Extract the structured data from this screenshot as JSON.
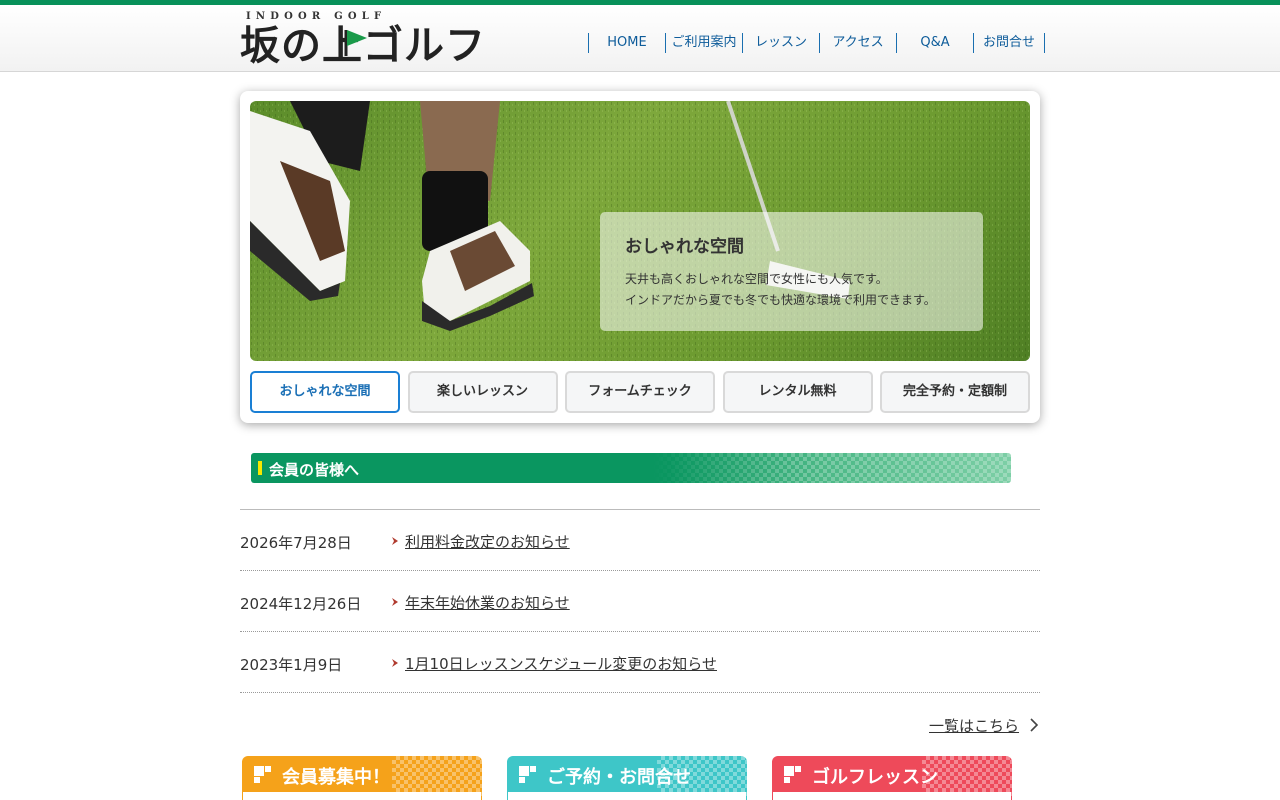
{
  "header": {
    "logo_sub": "INDOOR GOLF",
    "logo_main_1": "坂の",
    "logo_main_2": "上ゴルフ",
    "nav": [
      "HOME",
      "ご利用案内",
      "レッスン",
      "アクセス",
      "Q&A",
      "お問合せ"
    ]
  },
  "slider": {
    "caption_title": "おしゃれな空間",
    "caption_line1": "天井も高くおしゃれな空間で女性にも人気です。",
    "caption_line2": "インドアだから夏でも冬でも快適な環境で利用できます。",
    "tabs": [
      "おしゃれな空間",
      "楽しいレッスン",
      "フォームチェック",
      "レンタル無料",
      "完全予約・定額制"
    ],
    "active_tab": 0
  },
  "members": {
    "title": "会員の皆様へ"
  },
  "news": [
    {
      "date": "2026年7月28日",
      "title": "利用料金改定のお知らせ"
    },
    {
      "date": "2024年12月26日",
      "title": "年末年始休業のお知らせ"
    },
    {
      "date": "2023年1月9日",
      "title": "1月10日レッスンスケジュール変更のお知らせ"
    }
  ],
  "more_link": "一覧はこちら",
  "banners": [
    {
      "label": "会員募集中！",
      "color": "#f5a21a"
    },
    {
      "label": "ご予約・お問合せ",
      "color": "#3ec6c8"
    },
    {
      "label": "ゴルフレッスン",
      "color": "#ee4a5a"
    }
  ],
  "colors": {
    "brand_green": "#08915a",
    "nav_blue": "#0e5c9a",
    "active_tab": "#1a7fd4"
  }
}
